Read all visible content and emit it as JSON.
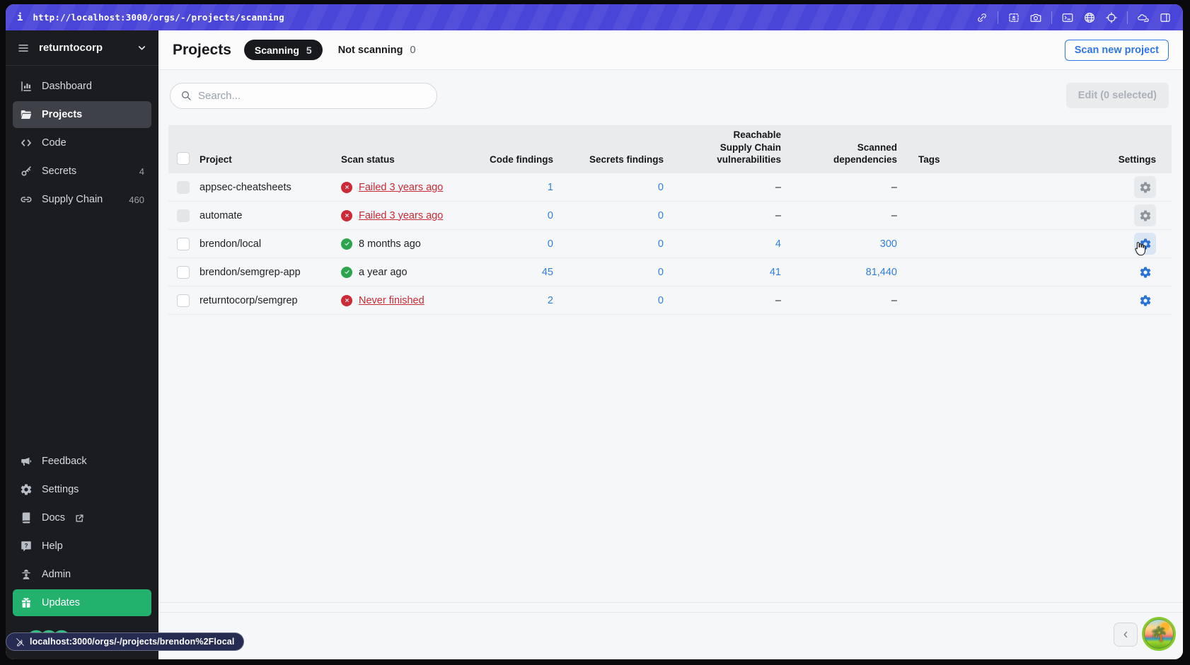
{
  "browser": {
    "url": "http://localhost:3000/orgs/-/projects/scanning",
    "status_link": "localhost:3000/orgs/-/projects/brendon%2Flocal",
    "toolbar_icons": [
      "info",
      "link",
      "image-capture",
      "camera",
      "terminal",
      "globe",
      "crosshair",
      "clouds",
      "split-view"
    ]
  },
  "sidebar": {
    "org": "returntocorp",
    "items": [
      {
        "label": "Dashboard",
        "icon": "dashboard-icon",
        "badge": ""
      },
      {
        "label": "Projects",
        "icon": "folder-icon",
        "badge": ""
      },
      {
        "label": "Code",
        "icon": "code-icon",
        "badge": ""
      },
      {
        "label": "Secrets",
        "icon": "key-icon",
        "badge": "4"
      },
      {
        "label": "Supply Chain",
        "icon": "chain-icon",
        "badge": "460"
      }
    ],
    "bottom_items": [
      {
        "label": "Feedback",
        "icon": "megaphone-icon"
      },
      {
        "label": "Settings",
        "icon": "gear-icon"
      },
      {
        "label": "Docs",
        "icon": "book-icon"
      },
      {
        "label": "Help",
        "icon": "help-icon"
      },
      {
        "label": "Admin",
        "icon": "admin-icon"
      },
      {
        "label": "Updates",
        "icon": "gift-icon"
      }
    ],
    "logo": "semgrep-rings-logo"
  },
  "header": {
    "title": "Projects",
    "tab_scanning": "Scanning",
    "tab_scanning_count": "5",
    "tab_not_scanning": "Not scanning",
    "tab_not_scanning_count": "0",
    "scan_new_label": "Scan new project"
  },
  "toolbar": {
    "search_placeholder": "Search...",
    "edit_label": "Edit (0 selected)"
  },
  "table": {
    "columns": {
      "project": "Project",
      "scan_status": "Scan status",
      "code_findings": "Code findings",
      "secrets_findings": "Secrets findings",
      "reachable": "Reachable\nSupply Chain\nvulnerabilities",
      "scanned": "Scanned\ndependencies",
      "tags": "Tags",
      "settings": "Settings"
    },
    "rows": [
      {
        "project": "appsec-cheatsheets",
        "status": "Failed 3 years ago",
        "status_kind": "failed",
        "code": "1",
        "secrets": "0",
        "reachable": "–",
        "scanned": "–",
        "tags": ""
      },
      {
        "project": "automate",
        "status": "Failed 3 years ago",
        "status_kind": "failed",
        "code": "0",
        "secrets": "0",
        "reachable": "–",
        "scanned": "–",
        "tags": ""
      },
      {
        "project": "brendon/local",
        "status": "8 months ago",
        "status_kind": "ok",
        "code": "0",
        "secrets": "0",
        "reachable": "4",
        "scanned": "300",
        "tags": ""
      },
      {
        "project": "brendon/semgrep-app",
        "status": "a year ago",
        "status_kind": "ok",
        "code": "45",
        "secrets": "0",
        "reachable": "41",
        "scanned": "81,440",
        "tags": ""
      },
      {
        "project": "returntocorp/semgrep",
        "status": "Never finished",
        "status_kind": "failed",
        "code": "2",
        "secrets": "0",
        "reachable": "–",
        "scanned": "–",
        "tags": ""
      }
    ]
  },
  "colors": {
    "topbar": "#4a45d9",
    "sidebar_bg": "#1a1c20",
    "accent_blue": "#2e76e5",
    "link_blue": "#2f7fe0",
    "failed_red": "#cb2a36",
    "success_green": "#2da44e",
    "updates_green": "#23b26e",
    "logo_green": "#35bd85",
    "table_header_bg": "#e9ebed",
    "status_pill_bg": "#262b52"
  }
}
